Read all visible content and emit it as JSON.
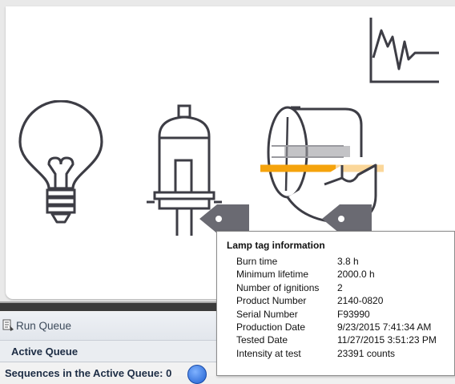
{
  "queue": {
    "run_queue_label": "Run Queue",
    "active_queue_label": "Active Queue",
    "sequences_label": "Sequences in the Active Queue: 0"
  },
  "lamp_tag": {
    "title": "Lamp tag information",
    "rows": [
      {
        "label": "Burn time",
        "value": "3.8 h"
      },
      {
        "label": "Minimum lifetime",
        "value": "2000.0 h"
      },
      {
        "label": "Number of ignitions",
        "value": "2"
      },
      {
        "label": "Product Number",
        "value": "2140-0820"
      },
      {
        "label": "Serial Number",
        "value": "F93990"
      },
      {
        "label": "Production Date",
        "value": "9/23/2015 7:41:34 AM"
      },
      {
        "label": "Tested Date",
        "value": "11/27/2015 3:51:23 PM"
      },
      {
        "label": "Intensity at test",
        "value": "23391 counts"
      }
    ]
  },
  "icons": {
    "chart": "signal-chart-icon",
    "bulb": "light-bulb-icon",
    "halogen": "halogen-lamp-icon",
    "deuterium": "deuterium-lamp-icon",
    "tag1": "lamp-tag-icon",
    "tag2": "lamp-tag-icon"
  },
  "colors": {
    "icon_stroke": "#3d3d45",
    "tag_fill": "#6a6a72",
    "beam_orange": "#f5a30c",
    "beam_light": "#fbd79a",
    "pause_blue": "#2f6fdc"
  }
}
